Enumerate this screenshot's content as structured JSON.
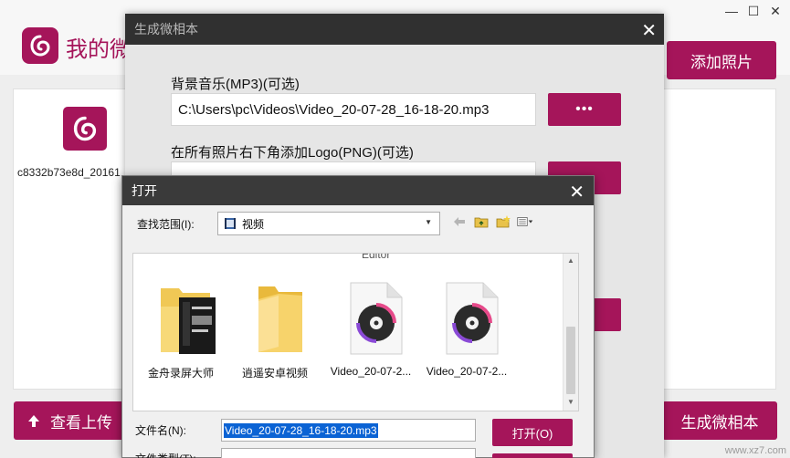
{
  "app": {
    "title": "我的微",
    "add_photo_button": "添加照片",
    "view_upload_button": "查看上传",
    "generate_button": "生成微相本",
    "thumbnail_caption": "c8332b73e8d_20161"
  },
  "generate_dialog": {
    "title": "生成微相本",
    "music_label": "背景音乐(MP3)(可选)",
    "music_path": "C:\\Users\\pc\\Videos\\Video_20-07-28_16-18-20.mp3",
    "browse_label": "•••",
    "logo_label": "在所有照片右下角添加Logo(PNG)(可选)"
  },
  "open_dialog": {
    "title": "打开",
    "look_in_label": "查找范围(I):",
    "look_in_value": "视频",
    "partial_label": "Editor",
    "files": [
      {
        "label": "金舟录屏大师",
        "type": "folder-screenshot"
      },
      {
        "label": "逍遥安卓视频",
        "type": "folder"
      },
      {
        "label": "Video_20-07-2...",
        "type": "audio"
      },
      {
        "label": "Video_20-07-2...",
        "type": "audio"
      }
    ],
    "file_name_label": "文件名(N):",
    "file_name_value": "Video_20-07-28_16-18-20.mp3",
    "file_type_label": "文件类型(T):",
    "open_button": "打开(O)"
  },
  "watermark": "www.xz7.com",
  "colors": {
    "accent": "#a5155a",
    "titlebar": "#303030"
  }
}
